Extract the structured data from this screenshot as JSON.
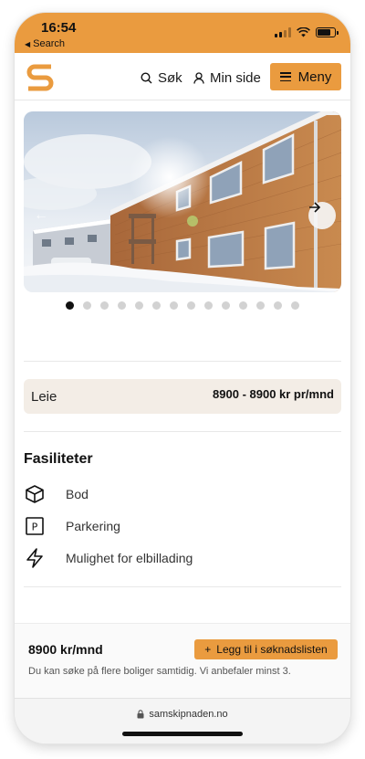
{
  "status_bar": {
    "time": "16:54",
    "back_label": "Search"
  },
  "header": {
    "search_label": "Søk",
    "my_page_label": "Min side",
    "menu_label": "Meny"
  },
  "colors": {
    "accent": "#ea9b3f",
    "rent_bg": "#f3ede6"
  },
  "carousel": {
    "image_count": 14,
    "active_index": 0
  },
  "rent": {
    "label": "Leie",
    "value": "8900 - 8900 kr pr/mnd"
  },
  "facilities": {
    "title": "Fasiliteter",
    "items": [
      {
        "icon": "box-icon",
        "label": "Bod"
      },
      {
        "icon": "parking-icon",
        "label": "Parkering"
      },
      {
        "icon": "lightning-icon",
        "label": "Mulighet for elbillading"
      }
    ]
  },
  "bottom_bar": {
    "price": "8900 kr/mnd",
    "add_button_label": "Legg til i søknadslisten",
    "note": "Du kan søke på flere boliger samtidig. Vi anbefaler minst 3."
  },
  "browser": {
    "url": "samskipnaden.no"
  }
}
